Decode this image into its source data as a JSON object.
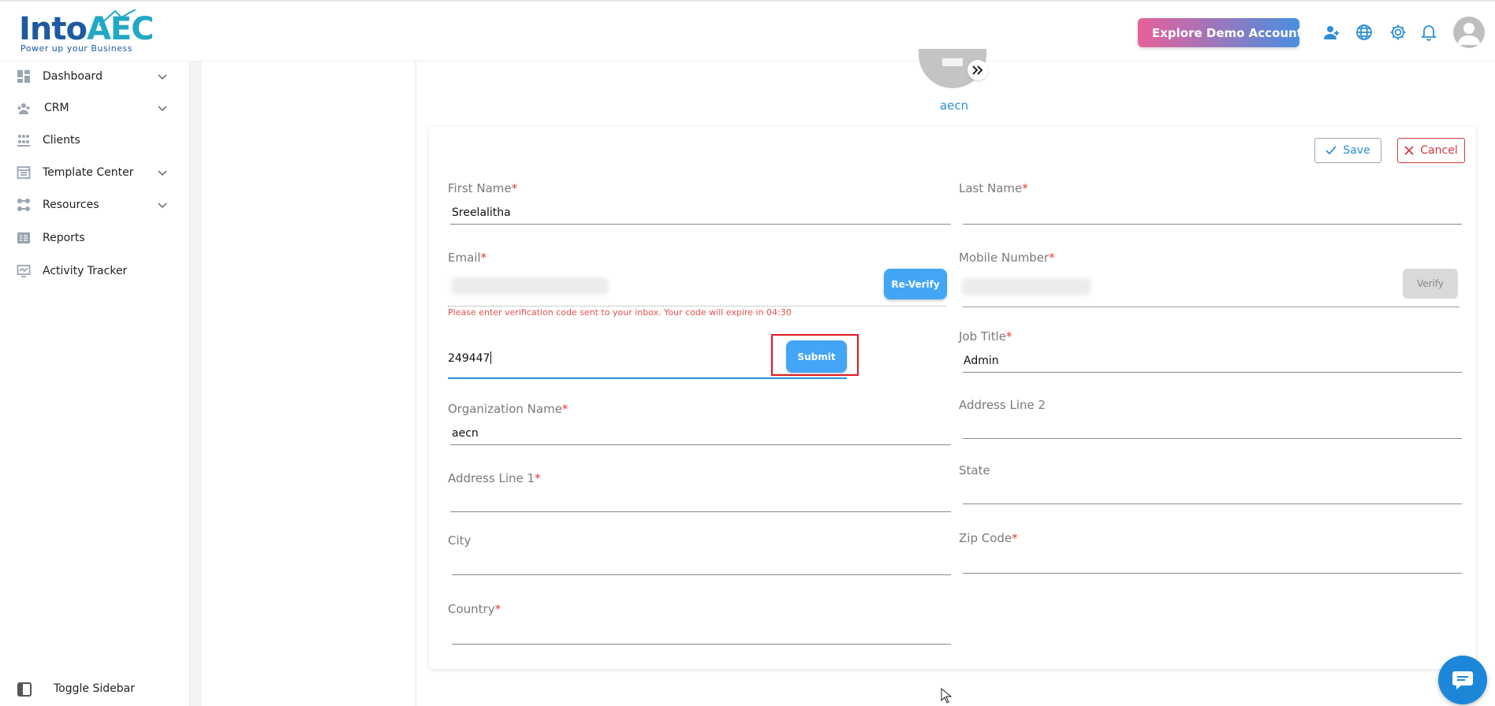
{
  "brand": {
    "logo_main": "Into",
    "logo_accent": "AEC",
    "tagline": "Power up your Business",
    "accent_color": "#42a5f5",
    "error_color": "#e53935"
  },
  "header": {
    "demo_button": "Explore Demo Account",
    "icons": [
      "add-user-icon",
      "globe-icon",
      "gear-icon",
      "bell-icon",
      "user-avatar-icon"
    ]
  },
  "sidebar": {
    "items": [
      {
        "label": "Dashboard",
        "icon": "dashboard-icon",
        "expandable": true
      },
      {
        "label": "CRM",
        "icon": "crm-icon",
        "expandable": true
      },
      {
        "label": "Clients",
        "icon": "clients-icon",
        "expandable": false
      },
      {
        "label": "Template Center",
        "icon": "template-icon",
        "expandable": true
      },
      {
        "label": "Resources",
        "icon": "resources-icon",
        "expandable": true
      },
      {
        "label": "Reports",
        "icon": "reports-icon",
        "expandable": false
      },
      {
        "label": "Activity Tracker",
        "icon": "activity-icon",
        "expandable": false
      }
    ],
    "toggle_label": "Toggle Sidebar"
  },
  "profile": {
    "name": "aecn"
  },
  "form": {
    "save_label": "Save",
    "cancel_label": "Cancel",
    "first_name": {
      "label": "First Name",
      "value": "Sreelalitha"
    },
    "last_name": {
      "label": "Last Name",
      "value": ""
    },
    "email": {
      "label": "Email",
      "reverify_label": "Re-Verify",
      "error": "Please enter verification code sent to your inbox. Your code will expire in 04:30"
    },
    "mobile": {
      "label": "Mobile Number",
      "verify_label": "Verify"
    },
    "code": {
      "value": "249447",
      "submit_label": "Submit"
    },
    "job_title": {
      "label": "Job Title",
      "value": "Admin"
    },
    "organization": {
      "label": "Organization Name",
      "value": "aecn"
    },
    "address2": {
      "label": "Address Line 2",
      "value": ""
    },
    "address1": {
      "label": "Address Line 1",
      "value": ""
    },
    "state": {
      "label": "State",
      "value": ""
    },
    "city": {
      "label": "City",
      "value": ""
    },
    "zip": {
      "label": "Zip Code",
      "value": ""
    },
    "country": {
      "label": "Country",
      "value": ""
    },
    "required_mark": "*"
  }
}
